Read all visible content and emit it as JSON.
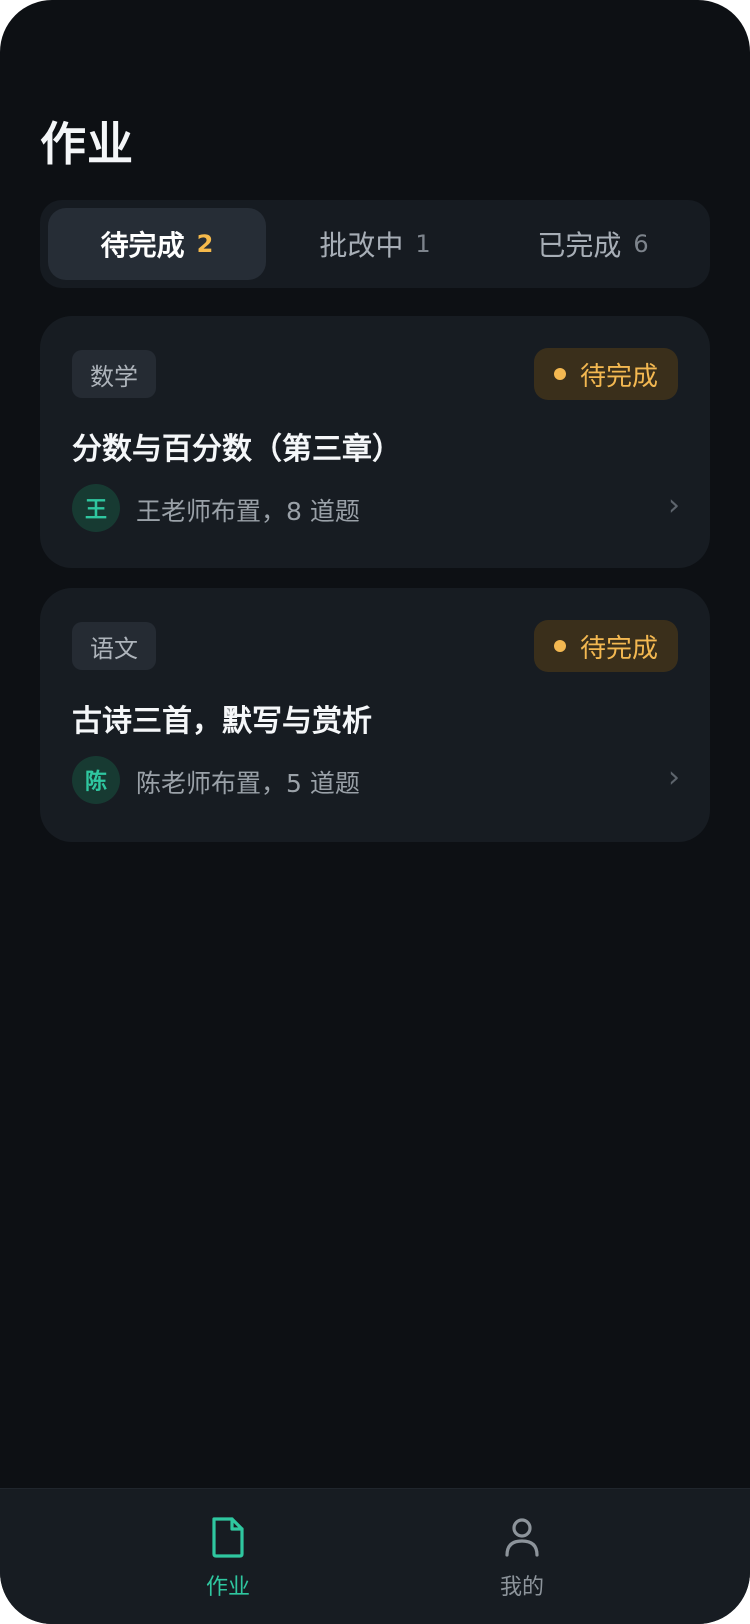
{
  "header": {
    "title": "作业"
  },
  "tabs": [
    {
      "label": "待完成",
      "count": "2",
      "active": true
    },
    {
      "label": "批改中",
      "count": "1",
      "active": false
    },
    {
      "label": "已完成",
      "count": "6",
      "active": false
    }
  ],
  "assignments": [
    {
      "subject": "数学",
      "status": "待完成",
      "title": "分数与百分数（第三章）",
      "teacher_initial": "王",
      "meta": "王老师布置，8 道题"
    },
    {
      "subject": "语文",
      "status": "待完成",
      "title": "古诗三首，默写与赏析",
      "teacher_initial": "陈",
      "meta": "陈老师布置，5 道题"
    }
  ],
  "chevron_glyph": "›",
  "bottom_nav": [
    {
      "label": "作业",
      "icon": "document-icon",
      "active": true
    },
    {
      "label": "我的",
      "icon": "user-icon",
      "active": false
    }
  ],
  "colors": {
    "background": "#0d1014",
    "accent": "#2fc7a0",
    "pending": "#f3b851"
  }
}
